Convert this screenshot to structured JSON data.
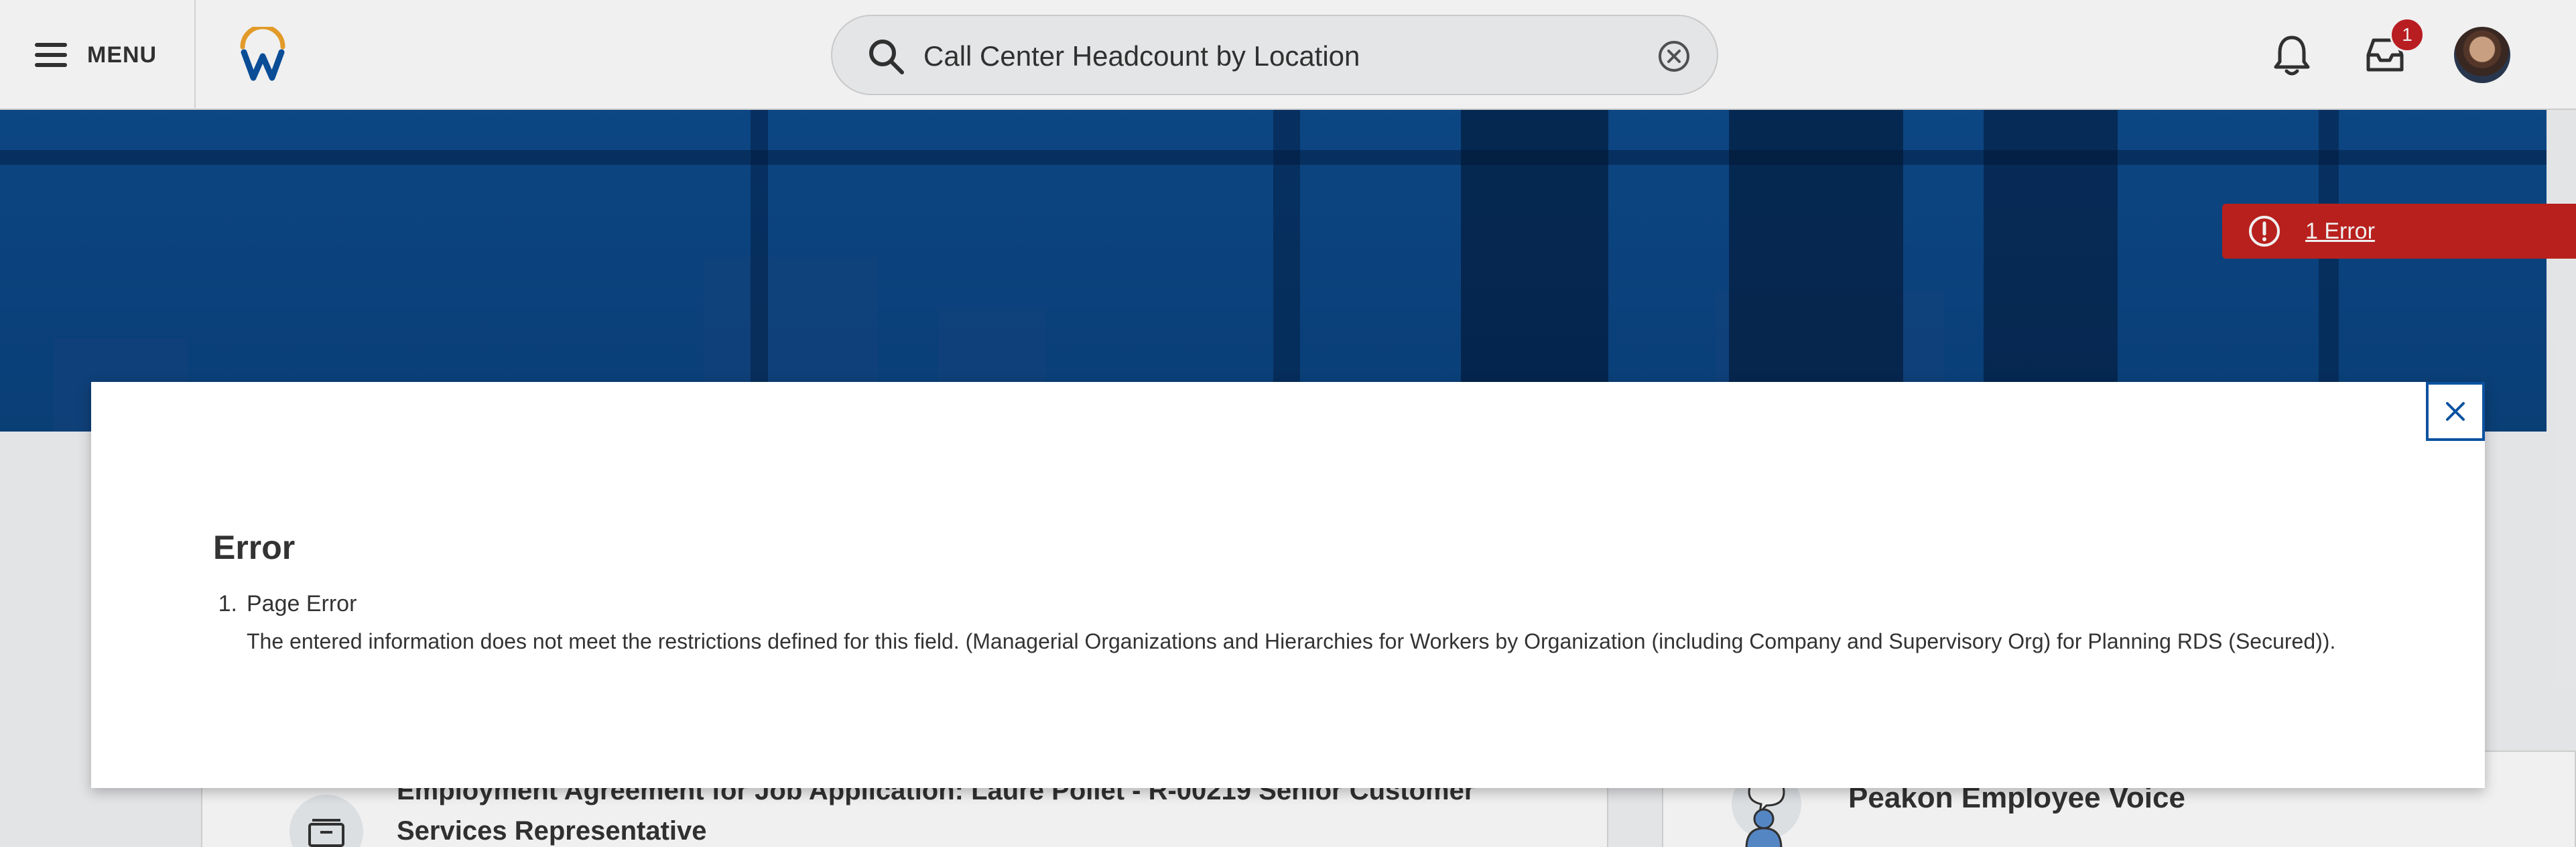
{
  "header": {
    "menu_label": "MENU",
    "search_value": "Call Center Headcount by Location",
    "inbox_badge": "1",
    "icons": [
      "menu-icon",
      "workday-logo",
      "search-icon",
      "clear-search-icon",
      "notifications-bell-icon",
      "inbox-icon",
      "avatar"
    ]
  },
  "banner": {
    "error_pill": "1 Error"
  },
  "modal": {
    "title": "Error",
    "errors": [
      {
        "number": "1.",
        "heading": "Page Error",
        "message": "The entered information does not meet the restrictions defined for this field. (Managerial Organizations and Hierarchies for Workers by Organization (including Company and Supervisory Org) for Planning RDS (Secured))."
      }
    ]
  },
  "cards": {
    "left_title": "Employment Agreement for Job Application: Laure Pollet - R-00219 Senior Customer Services Representative",
    "right_title": "Peakon Employee Voice"
  },
  "colors": {
    "banner_blue": "#0d4b8c",
    "error_red": "#c4221f",
    "accent_blue": "#0b52a0",
    "logo_gold": "#f1a52b"
  }
}
